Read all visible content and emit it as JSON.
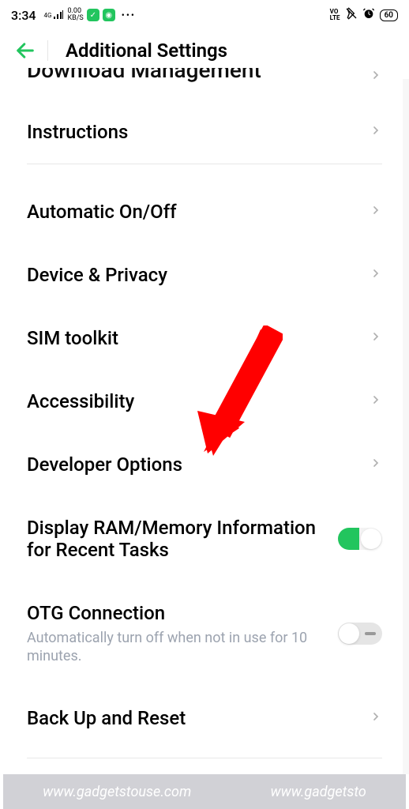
{
  "status": {
    "time": "3:34",
    "signal_label": "4G",
    "kbs_top": "0.00",
    "kbs_bottom": "KB/S",
    "volte": "VO\nLTE",
    "battery": "60"
  },
  "header": {
    "title": "Additional Settings"
  },
  "partial_item": {
    "label": "Download Management"
  },
  "items": [
    {
      "label": "Instructions",
      "type": "chevron"
    }
  ],
  "items2": [
    {
      "label": "Automatic On/Off",
      "type": "chevron"
    },
    {
      "label": "Device & Privacy",
      "type": "chevron"
    },
    {
      "label": "SIM toolkit",
      "type": "chevron"
    },
    {
      "label": "Accessibility",
      "type": "chevron"
    },
    {
      "label": "Developer Options",
      "type": "chevron"
    },
    {
      "label": "Display RAM/Memory Information for Recent Tasks",
      "type": "toggle",
      "on": true
    },
    {
      "label": "OTG Connection",
      "subtitle": "Automatically turn off when not in use for 10 minutes.",
      "type": "toggle",
      "on": false
    },
    {
      "label": "Back Up and Reset",
      "type": "chevron"
    }
  ],
  "watermark": {
    "left": "www.gadgetstouse.com",
    "right": "www.gadgetsto"
  }
}
